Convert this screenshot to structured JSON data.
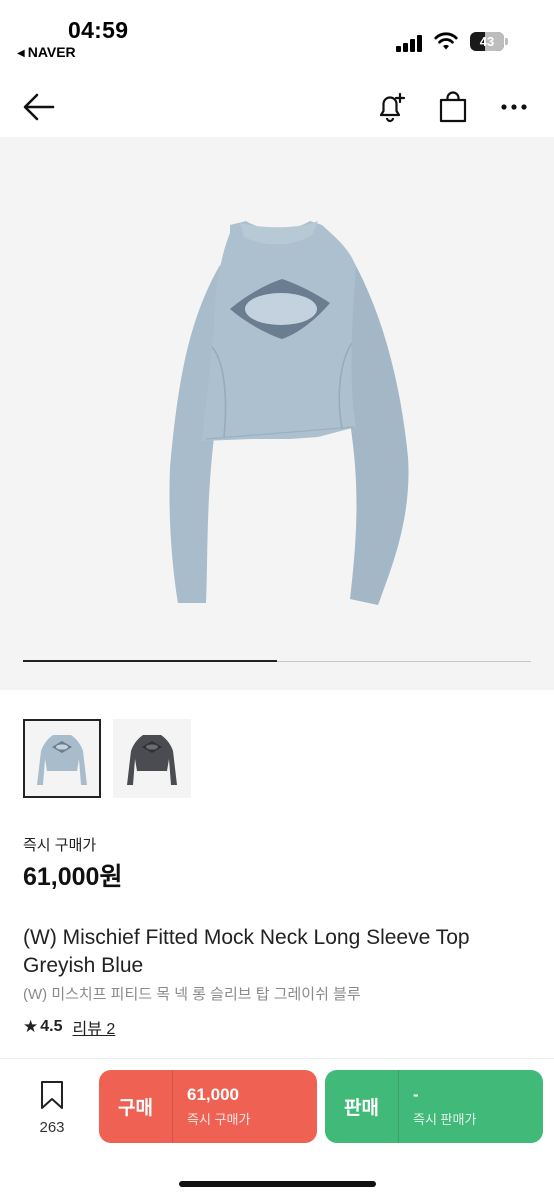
{
  "status_bar": {
    "time": "04:59",
    "back_app": "NAVER",
    "battery_level": "43",
    "battery_fraction": 0.43
  },
  "nav": {
    "back_icon": "arrow-left-icon",
    "alert_icon": "bell-plus-icon",
    "cart_icon": "shopping-bag-icon",
    "more_icon": "more-horizontal-icon"
  },
  "gallery": {
    "image_count": 2,
    "current_index": 1,
    "progress_fraction": 0.5,
    "thumbnails": [
      {
        "color": "#a9bccb",
        "selected": true
      },
      {
        "color": "#4b4c51",
        "selected": false
      }
    ]
  },
  "price": {
    "label": "즉시 구매가",
    "value": "61,000원"
  },
  "product": {
    "title_en": "(W) Mischief Fitted Mock Neck Long Sleeve Top Greyish Blue",
    "title_ko": "(W) 미스치프 피티드 목 넥 롱 슬리브 탑 그레이쉬 블루",
    "rating": "4.5",
    "review_text": "리뷰 2"
  },
  "bottom_bar": {
    "wish_icon": "bookmark-icon",
    "wish_count": "263",
    "buy": {
      "label": "구매",
      "price": "61,000",
      "sub": "즉시 구매가",
      "color": "#ef6253"
    },
    "sell": {
      "label": "판매",
      "price": "-",
      "sub": "즉시 판매가",
      "color": "#41b979"
    }
  }
}
